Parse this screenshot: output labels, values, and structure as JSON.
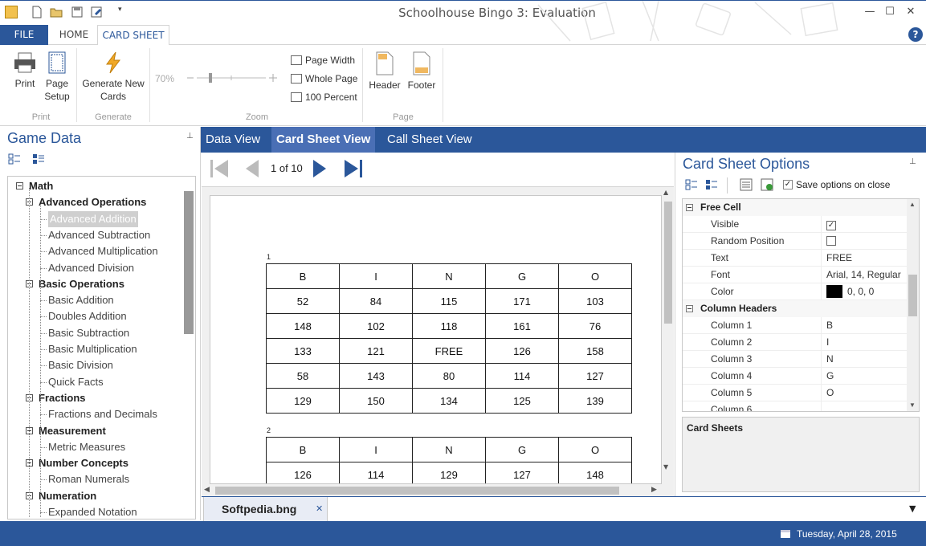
{
  "window": {
    "title": "Schoolhouse Bingo 3: Evaluation",
    "controls": [
      "minimize-icon",
      "maximize-icon",
      "close-icon"
    ]
  },
  "ribbon_tabs": [
    {
      "label": "FILE"
    },
    {
      "label": "HOME"
    },
    {
      "label": "CARD SHEET"
    }
  ],
  "ribbon": {
    "print": {
      "label": "Print"
    },
    "page_setup": {
      "label": "Page\nSetup",
      "line1": "Page",
      "line2": "Setup"
    },
    "generate": {
      "line1": "Generate New",
      "line2": "Cards"
    },
    "zoom_value": "70%",
    "zoom_items": [
      {
        "label": "Page Width"
      },
      {
        "label": "Whole Page"
      },
      {
        "label": "100 Percent"
      }
    ],
    "header": {
      "label": "Header"
    },
    "footer": {
      "label": "Footer"
    },
    "groups": {
      "print": "Print",
      "generate": "Generate",
      "zoom": "Zoom",
      "page": "Page"
    }
  },
  "left_panel": {
    "title": "Game Data",
    "tree": [
      {
        "label": "Math",
        "level": 0,
        "bold": true
      },
      {
        "label": "Advanced Operations",
        "level": 1,
        "bold": true
      },
      {
        "label": "Advanced Addition",
        "level": 2,
        "selected": true
      },
      {
        "label": "Advanced Subtraction",
        "level": 2
      },
      {
        "label": "Advanced Multiplication",
        "level": 2
      },
      {
        "label": "Advanced Division",
        "level": 2
      },
      {
        "label": "Basic Operations",
        "level": 1,
        "bold": true
      },
      {
        "label": "Basic Addition",
        "level": 2
      },
      {
        "label": "Doubles Addition",
        "level": 2
      },
      {
        "label": "Basic Subtraction",
        "level": 2
      },
      {
        "label": "Basic Multiplication",
        "level": 2
      },
      {
        "label": "Basic Division",
        "level": 2
      },
      {
        "label": "Quick Facts",
        "level": 2
      },
      {
        "label": "Fractions",
        "level": 1,
        "bold": true
      },
      {
        "label": "Fractions and Decimals",
        "level": 2
      },
      {
        "label": "Measurement",
        "level": 1,
        "bold": true
      },
      {
        "label": "Metric Measures",
        "level": 2
      },
      {
        "label": "Number Concepts",
        "level": 1,
        "bold": true
      },
      {
        "label": "Roman Numerals",
        "level": 2
      },
      {
        "label": "Numeration",
        "level": 1,
        "bold": true
      },
      {
        "label": "Expanded Notation",
        "level": 2
      }
    ]
  },
  "view_tabs": [
    {
      "label": "Data View"
    },
    {
      "label": "Card Sheet View",
      "active": true
    },
    {
      "label": "Call Sheet View"
    }
  ],
  "navigation": {
    "page_indicator": "1 of 10"
  },
  "cards": [
    {
      "number": "1",
      "header": [
        "B",
        "I",
        "N",
        "G",
        "O"
      ],
      "rows": [
        [
          "52",
          "84",
          "115",
          "171",
          "103"
        ],
        [
          "148",
          "102",
          "118",
          "161",
          "76"
        ],
        [
          "133",
          "121",
          "FREE",
          "126",
          "158"
        ],
        [
          "58",
          "143",
          "80",
          "114",
          "127"
        ],
        [
          "129",
          "150",
          "134",
          "125",
          "139"
        ]
      ]
    },
    {
      "number": "2",
      "header": [
        "B",
        "I",
        "N",
        "G",
        "O"
      ],
      "rows": [
        [
          "126",
          "114",
          "129",
          "127",
          "148"
        ]
      ]
    }
  ],
  "document_tab": {
    "label": "Softpedia.bng"
  },
  "right_panel": {
    "title": "Card Sheet Options",
    "save_on_close": {
      "label": "Save options on close",
      "checked": true
    },
    "categories": [
      {
        "name": "Free Cell",
        "rows": [
          {
            "name": "Visible",
            "value": "",
            "type": "checkbox",
            "checked": true
          },
          {
            "name": "Random Position",
            "value": "",
            "type": "checkbox",
            "checked": false
          },
          {
            "name": "Text",
            "value": "FREE"
          },
          {
            "name": "Font",
            "value": "Arial, 14, Regular"
          },
          {
            "name": "Color",
            "value": "0, 0, 0",
            "swatch": "#000000"
          }
        ]
      },
      {
        "name": "Column Headers",
        "rows": [
          {
            "name": "Column 1",
            "value": "B"
          },
          {
            "name": "Column 2",
            "value": "I"
          },
          {
            "name": "Column 3",
            "value": "N"
          },
          {
            "name": "Column 4",
            "value": "G"
          },
          {
            "name": "Column 5",
            "value": "O"
          },
          {
            "name": "Column 6",
            "value": ""
          }
        ]
      }
    ],
    "card_sheets_label": "Card Sheets"
  },
  "status": {
    "date": "Tuesday, April 28, 2015"
  },
  "colors": {
    "accent": "#2b579a",
    "active_tab": "#4a6fb5",
    "selection": "#cfcfcf"
  }
}
